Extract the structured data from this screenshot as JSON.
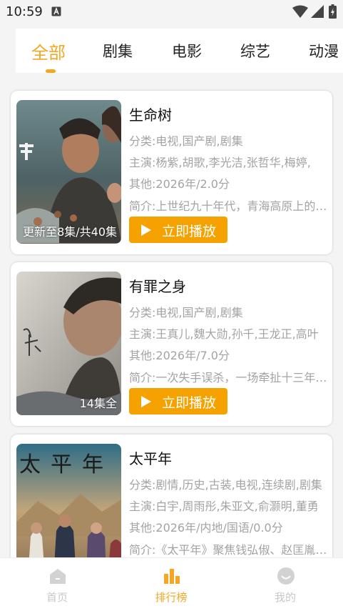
{
  "status_bar": {
    "time": "10:59"
  },
  "tabs": [
    {
      "label": "全部",
      "active": true
    },
    {
      "label": "剧集",
      "active": false
    },
    {
      "label": "电影",
      "active": false
    },
    {
      "label": "综艺",
      "active": false
    },
    {
      "label": "动漫",
      "active": false
    }
  ],
  "colors": {
    "accent": "#f5a623",
    "button": "#f5a200",
    "meta_text": "#a3a3a3"
  },
  "cards": [
    {
      "title": "生命树",
      "badge": "更新至8集/共40集",
      "category": "分类:电视,国产剧,剧集",
      "cast": "主演:杨紫,胡歌,李光洁,张哲华,梅婷,",
      "other": "其他:2026年/2.0分",
      "intro": "简介:上世纪九十年代，青海高原上的可可西里",
      "play_label": "立即播放"
    },
    {
      "title": "有罪之身",
      "badge": "14集全",
      "category": "分类:电视,国产剧,剧集",
      "cast": "主演:王真儿,魏大勋,孙千,王龙正,高叶",
      "other": "其他:2026年/7.0分",
      "intro": "简介:一次失手误杀，一场牵扯十三年的罪案",
      "play_label": "立即播放"
    },
    {
      "title": "太平年",
      "badge": "",
      "category": "分类:剧情,历史,古装,电视,连续剧,剧集",
      "cast": "主演:白宇,周雨彤,朱亚文,俞灏明,董勇",
      "other": "其他:2026年/内地/国语/0.0分",
      "intro": "简介:《太平年》聚焦钱弘俶、赵匡胤等人物",
      "play_label": "立即播放",
      "poster_text": "太平年"
    }
  ],
  "bottom_nav": [
    {
      "label": "首页",
      "icon": "home-icon",
      "active": false
    },
    {
      "label": "排行榜",
      "icon": "ranking-icon",
      "active": true
    },
    {
      "label": "我的",
      "icon": "profile-icon",
      "active": false
    }
  ]
}
